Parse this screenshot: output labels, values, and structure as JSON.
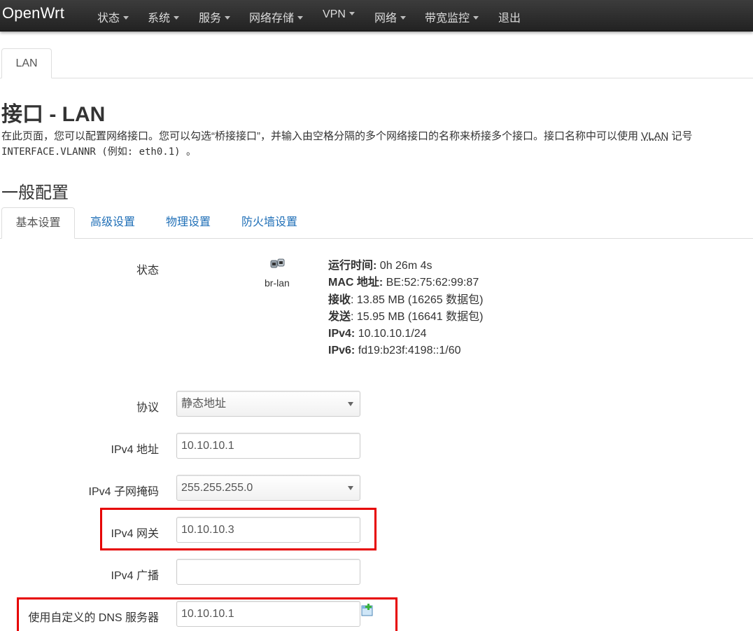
{
  "navbar": {
    "brand": "OpenWrt",
    "menus": [
      {
        "label": "状态",
        "has_dropdown": true
      },
      {
        "label": "系统",
        "has_dropdown": true
      },
      {
        "label": "服务",
        "has_dropdown": true
      },
      {
        "label": "网络存储",
        "has_dropdown": true
      },
      {
        "label": "VPN",
        "has_dropdown": true
      },
      {
        "label": "网络",
        "has_dropdown": true
      },
      {
        "label": "带宽监控",
        "has_dropdown": true
      },
      {
        "label": "退出",
        "has_dropdown": false
      }
    ]
  },
  "top_tabs": [
    {
      "label": "LAN",
      "active": true
    }
  ],
  "page": {
    "title": "接口 - LAN",
    "description_before": "在此页面，您可以配置网络接口。您可以勾选“桥接接口”，并输入由空格分隔的多个网络接口的名称来桥接多个接口。接口名称中可以使用 ",
    "description_abbr": "VLAN",
    "description_after": " 记号",
    "description_code": "INTERFACE.VLANNR (例如: eth0.1) 。"
  },
  "section": {
    "title": "一般配置",
    "tabs": [
      {
        "label": "基本设置",
        "active": true
      },
      {
        "label": "高级设置",
        "active": false
      },
      {
        "label": "物理设置",
        "active": false
      },
      {
        "label": "防火墙设置",
        "active": false
      }
    ]
  },
  "status": {
    "label": "状态",
    "icon": "ethernet-port-icon",
    "interface_name": "br-lan",
    "lines": [
      {
        "key": "运行时间:",
        "value": " 0h 26m 4s"
      },
      {
        "key": "MAC 地址:",
        "value": " BE:52:75:62:99:87"
      },
      {
        "key": "接收",
        "value": ": 13.85 MB (16265 数据包)"
      },
      {
        "key": "发送",
        "value": ": 15.95 MB (16641 数据包)"
      },
      {
        "key": "IPv4:",
        "value": " 10.10.10.1/24"
      },
      {
        "key": "IPv6:",
        "value": " fd19:b23f:4198::1/60"
      }
    ]
  },
  "form": {
    "protocol": {
      "label": "协议",
      "value": "静态地址"
    },
    "ipv4_address": {
      "label": "IPv4 地址",
      "value": "10.10.10.1"
    },
    "ipv4_netmask": {
      "label": "IPv4 子网掩码",
      "value": "255.255.255.0"
    },
    "ipv4_gateway": {
      "label": "IPv4 网关",
      "value": "10.10.10.3"
    },
    "ipv4_broadcast": {
      "label": "IPv4 广播",
      "value": ""
    },
    "custom_dns": {
      "label": "使用自定义的 DNS 服务器",
      "value": "10.10.10.1"
    }
  },
  "colors": {
    "highlight": "#e60000",
    "link": "#1f6fb7",
    "navbar": "#2b2b2b"
  }
}
